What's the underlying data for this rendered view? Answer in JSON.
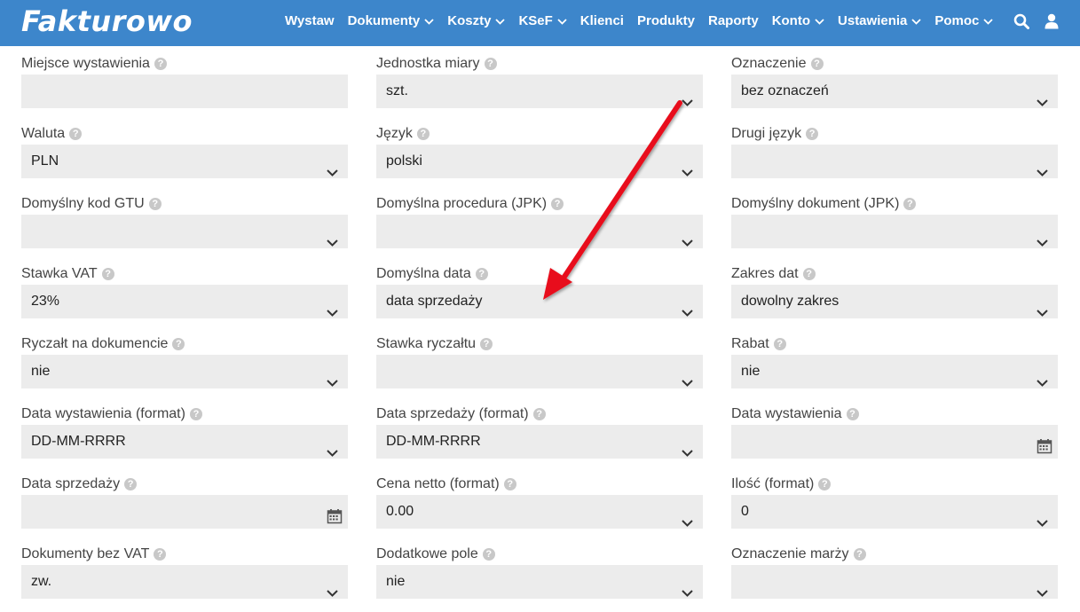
{
  "brand": {
    "logo": "Fakturowo",
    "nav_color": "#3d86cb"
  },
  "nav": {
    "items": [
      {
        "label": "Wystaw",
        "dropdown": false
      },
      {
        "label": "Dokumenty",
        "dropdown": true
      },
      {
        "label": "Koszty",
        "dropdown": true
      },
      {
        "label": "KSeF",
        "dropdown": true
      },
      {
        "label": "Klienci",
        "dropdown": false
      },
      {
        "label": "Produkty",
        "dropdown": false
      },
      {
        "label": "Raporty",
        "dropdown": false
      },
      {
        "label": "Konto",
        "dropdown": true
      },
      {
        "label": "Ustawienia",
        "dropdown": true
      },
      {
        "label": "Pomoc",
        "dropdown": true
      }
    ],
    "icons": [
      "search-icon",
      "user-icon"
    ]
  },
  "form": {
    "fields": [
      {
        "label": "Miejsce wystawienia",
        "type": "text",
        "value": ""
      },
      {
        "label": "Jednostka miary",
        "type": "select",
        "value": "szt."
      },
      {
        "label": "Oznaczenie",
        "type": "select",
        "value": "bez oznaczeń"
      },
      {
        "label": "Waluta",
        "type": "select",
        "value": "PLN"
      },
      {
        "label": "Język",
        "type": "select",
        "value": "polski"
      },
      {
        "label": "Drugi język",
        "type": "select",
        "value": ""
      },
      {
        "label": "Domyślny kod GTU",
        "type": "select",
        "value": ""
      },
      {
        "label": "Domyślna procedura (JPK)",
        "type": "select",
        "value": ""
      },
      {
        "label": "Domyślny dokument (JPK)",
        "type": "select",
        "value": ""
      },
      {
        "label": "Stawka VAT",
        "type": "select",
        "value": "23%"
      },
      {
        "label": "Domyślna data",
        "type": "select",
        "value": "data sprzedaży"
      },
      {
        "label": "Zakres dat",
        "type": "select",
        "value": "dowolny zakres"
      },
      {
        "label": "Ryczałt na dokumencie",
        "type": "select",
        "value": "nie"
      },
      {
        "label": "Stawka ryczałtu",
        "type": "select",
        "value": ""
      },
      {
        "label": "Rabat",
        "type": "select",
        "value": "nie"
      },
      {
        "label": "Data wystawienia (format)",
        "type": "select",
        "value": "DD-MM-RRRR"
      },
      {
        "label": "Data sprzedaży (format)",
        "type": "select",
        "value": "DD-MM-RRRR"
      },
      {
        "label": "Data wystawienia",
        "type": "date",
        "value": ""
      },
      {
        "label": "Data sprzedaży",
        "type": "date",
        "value": ""
      },
      {
        "label": "Cena netto (format)",
        "type": "select",
        "value": "0.00"
      },
      {
        "label": "Ilość (format)",
        "type": "select",
        "value": "0"
      },
      {
        "label": "Dokumenty bez VAT",
        "type": "select",
        "value": "zw."
      },
      {
        "label": "Dodatkowe pole",
        "type": "select",
        "value": "nie"
      },
      {
        "label": "Oznaczenie marży",
        "type": "select",
        "value": ""
      }
    ],
    "help_glyph": "?"
  },
  "annotation": {
    "color": "#e8101a",
    "points_to": "Domyślna data"
  }
}
